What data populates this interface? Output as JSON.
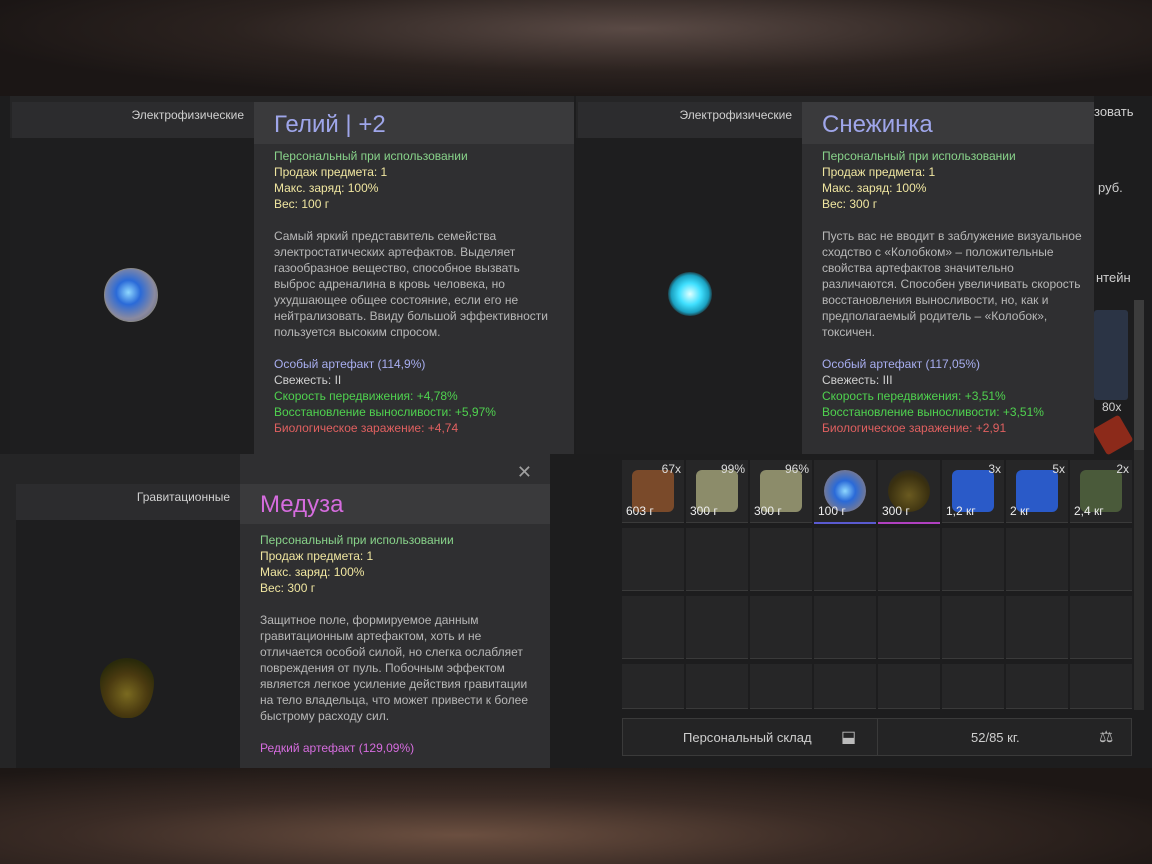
{
  "cards": [
    {
      "category": "Электрофизические",
      "title": "Гелий | +2",
      "stats": [
        "Персональный при использовании",
        "Продаж предмета: 1",
        "Макс. заряд: 100%",
        "Вес: 100 г"
      ],
      "description": "Самый яркий представитель семейства электростатических артефактов. Выделяет газообразное вещество, способное вызвать выброс адреналина в кровь человека, но ухудшающее общее состояние, если его не нейтрализовать. Ввиду большой эффективности пользуется высоким спросом.",
      "rarity": "Особый артефакт (114,9%)",
      "freshness": "Свежесть: II",
      "buff1": "Скорость передвижения: +4,78%",
      "buff2": "Восстановление выносливости: +5,97%",
      "debuff": "Биологическое заражение: +4,74"
    },
    {
      "category": "Электрофизические",
      "title": "Снежинка",
      "stats": [
        "Персональный при использовании",
        "Продаж предмета: 1",
        "Макс. заряд: 100%",
        "Вес: 300 г"
      ],
      "description": "Пусть вас не вводит в заблужение визуальное сходство с «Колобком» – положительные свойства артефактов значительно различаются. Способен увеличивать скорость восстановления выносливости, но, как и предполагаемый родитель – «Колобок», токсичен.",
      "rarity": "Особый артефакт (117,05%)",
      "freshness": "Свежесть: III",
      "buff1": "Скорость передвижения: +3,51%",
      "buff2": "Восстановление выносливости: +3,51%",
      "debuff": "Биологическое заражение: +2,91"
    },
    {
      "category": "Гравитационные",
      "title": "Медуза",
      "stats": [
        "Персональный при использовании",
        "Продаж предмета: 1",
        "Макс. заряд: 100%",
        "Вес: 300 г"
      ],
      "description": "Защитное поле, формируемое данным гравитационным артефактом, хоть и не отличается особой силой, но слегка ослабляет повреждения от пуль. Побочным эффектом является легкое усиление действия гравитации на тело владельца, что может привести к более быстрому расходу сил.",
      "rarity": "Редкий артефакт (129,09%)",
      "close": "✕"
    }
  ],
  "inventory": {
    "items": [
      {
        "count": "67x",
        "weight": "603 г",
        "color": "#7a4a2a"
      },
      {
        "count": "99%",
        "weight": "300 г",
        "color": "#8c8c6a"
      },
      {
        "count": "96%",
        "weight": "300 г",
        "color": "#8c8c6a"
      },
      {
        "count": "",
        "weight": "100 г",
        "color": "#3a5aa8"
      },
      {
        "count": "",
        "weight": "300 г",
        "color": "#4b3a1a"
      },
      {
        "count": "3x",
        "weight": "1,2 кг",
        "color": "#2a5ac8"
      },
      {
        "count": "5x",
        "weight": "2 кг",
        "color": "#2a5ac8"
      },
      {
        "count": "2x",
        "weight": "2,4 кг",
        "color": "#4a5a3a"
      }
    ],
    "peek_count": "80x"
  },
  "footer": {
    "label": "Персональный склад",
    "weight": "52/85 кг."
  },
  "right_peek": {
    "top": "зовать",
    "middle": "руб.",
    "side": "нтейн"
  }
}
